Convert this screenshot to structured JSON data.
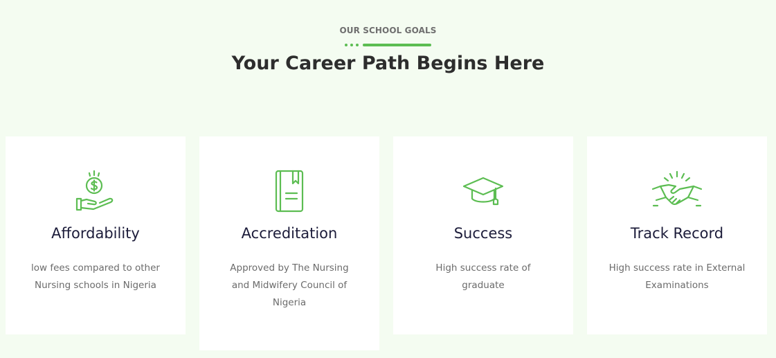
{
  "header": {
    "eyebrow": "OUR SCHOOL GOALS",
    "title": "Your Career Path Begins Here"
  },
  "colors": {
    "accent": "#5cbd52",
    "background": "#f4fcf1",
    "card": "#ffffff",
    "title_text": "#1c1c3a",
    "body_text": "#6b6b6b"
  },
  "cards": [
    {
      "icon": "money-hand-icon",
      "title": "Affordability",
      "description": "low fees compared to other Nursing schools in Nigeria"
    },
    {
      "icon": "book-icon",
      "title": "Accreditation",
      "description": "Approved by The Nursing and Midwifery Council of Nigeria"
    },
    {
      "icon": "graduation-cap-icon",
      "title": "Success",
      "description": "High success rate of graduate"
    },
    {
      "icon": "handshake-icon",
      "title": "Track Record",
      "description": "High success rate in External Examinations"
    }
  ]
}
